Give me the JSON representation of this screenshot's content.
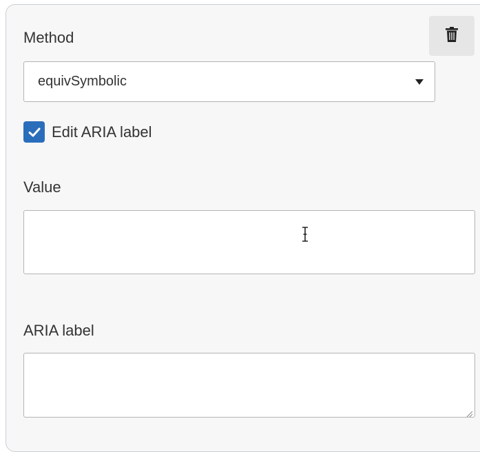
{
  "method": {
    "label": "Method",
    "selected": "equivSymbolic"
  },
  "aria_toggle": {
    "label": "Edit ARIA label",
    "checked": true
  },
  "value_field": {
    "label": "Value",
    "value": ""
  },
  "aria_field": {
    "label": "ARIA label",
    "value": ""
  },
  "icons": {
    "delete": "trash-icon",
    "dropdown": "caret-down-icon",
    "check": "checkmark-icon",
    "cursor": "text-cursor-icon"
  },
  "colors": {
    "panel_bg": "#f7f7f7",
    "checkbox_accent": "#2a6ebb",
    "delete_button_bg": "#e6e6e6",
    "border": "#b3b3b3"
  }
}
